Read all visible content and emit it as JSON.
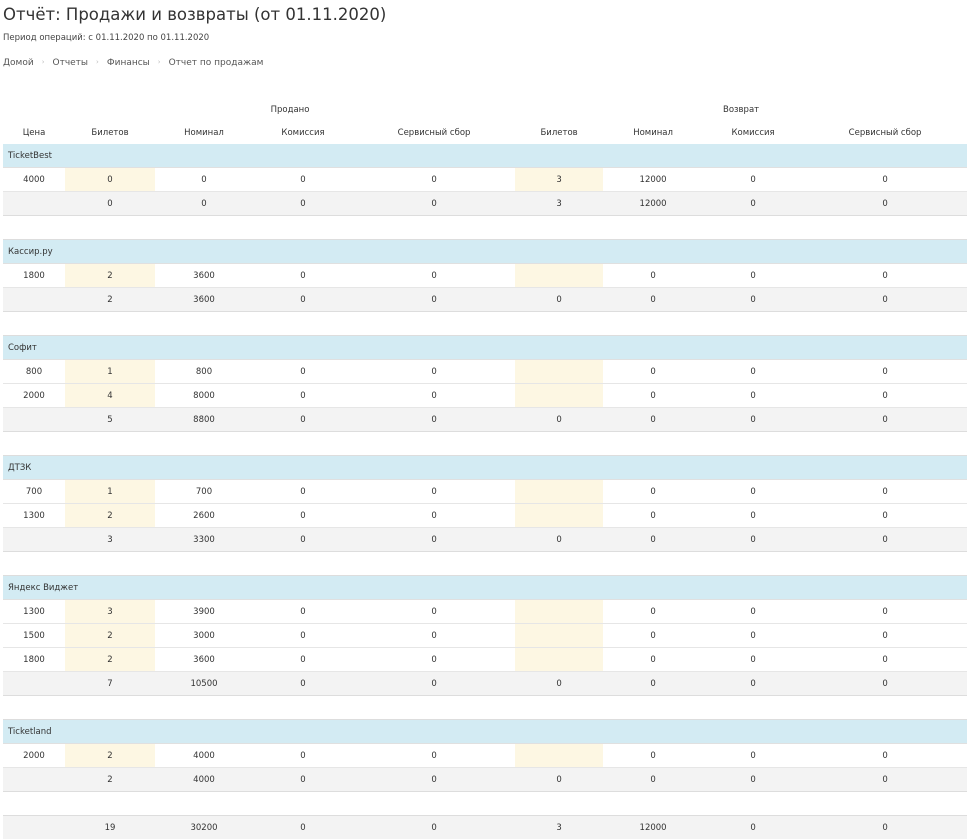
{
  "header": {
    "title": "Отчёт: Продажи и возвраты (от 01.11.2020)",
    "period": "Период операций: с 01.11.2020 по 01.11.2020"
  },
  "breadcrumb": [
    "Домой",
    "Отчеты",
    "Финансы",
    "Отчет по продажам"
  ],
  "table": {
    "groups": {
      "sold": "Продано",
      "returned": "Возврат"
    },
    "columns": [
      "Цена",
      "Билетов",
      "Номинал",
      "Комиссия",
      "Сервисный сбор",
      "Билетов",
      "Номинал",
      "Комиссия",
      "Сервисный сбор"
    ],
    "sections": [
      {
        "name": "TicketBest",
        "rows": [
          [
            "4000",
            "0",
            "0",
            "0",
            "0",
            "3",
            "12000",
            "0",
            "0"
          ]
        ],
        "total": [
          "",
          "0",
          "0",
          "0",
          "0",
          "3",
          "12000",
          "0",
          "0"
        ]
      },
      {
        "name": "Кассир.ру",
        "rows": [
          [
            "1800",
            "2",
            "3600",
            "0",
            "0",
            "",
            "0",
            "0",
            "0"
          ]
        ],
        "total": [
          "",
          "2",
          "3600",
          "0",
          "0",
          "0",
          "0",
          "0",
          "0"
        ]
      },
      {
        "name": "Софит",
        "rows": [
          [
            "800",
            "1",
            "800",
            "0",
            "0",
            "",
            "0",
            "0",
            "0"
          ],
          [
            "2000",
            "4",
            "8000",
            "0",
            "0",
            "",
            "0",
            "0",
            "0"
          ]
        ],
        "total": [
          "",
          "5",
          "8800",
          "0",
          "0",
          "0",
          "0",
          "0",
          "0"
        ]
      },
      {
        "name": "ДТЗК",
        "rows": [
          [
            "700",
            "1",
            "700",
            "0",
            "0",
            "",
            "0",
            "0",
            "0"
          ],
          [
            "1300",
            "2",
            "2600",
            "0",
            "0",
            "",
            "0",
            "0",
            "0"
          ]
        ],
        "total": [
          "",
          "3",
          "3300",
          "0",
          "0",
          "0",
          "0",
          "0",
          "0"
        ]
      },
      {
        "name": "Яндекс Виджет",
        "rows": [
          [
            "1300",
            "3",
            "3900",
            "0",
            "0",
            "",
            "0",
            "0",
            "0"
          ],
          [
            "1500",
            "2",
            "3000",
            "0",
            "0",
            "",
            "0",
            "0",
            "0"
          ],
          [
            "1800",
            "2",
            "3600",
            "0",
            "0",
            "",
            "0",
            "0",
            "0"
          ]
        ],
        "total": [
          "",
          "7",
          "10500",
          "0",
          "0",
          "0",
          "0",
          "0",
          "0"
        ]
      },
      {
        "name": "Ticketland",
        "rows": [
          [
            "2000",
            "2",
            "4000",
            "0",
            "0",
            "",
            "0",
            "0",
            "0"
          ]
        ],
        "total": [
          "",
          "2",
          "4000",
          "0",
          "0",
          "0",
          "0",
          "0",
          "0"
        ]
      }
    ],
    "grand_total": [
      "",
      "19",
      "30200",
      "0",
      "0",
      "3",
      "12000",
      "0",
      "0"
    ]
  },
  "colors": {
    "section_background": "#d3ebf3",
    "ticket_highlight": "#fdf7e3",
    "total_background": "#f3f3f3",
    "muted_text": "#b5b5b5"
  }
}
